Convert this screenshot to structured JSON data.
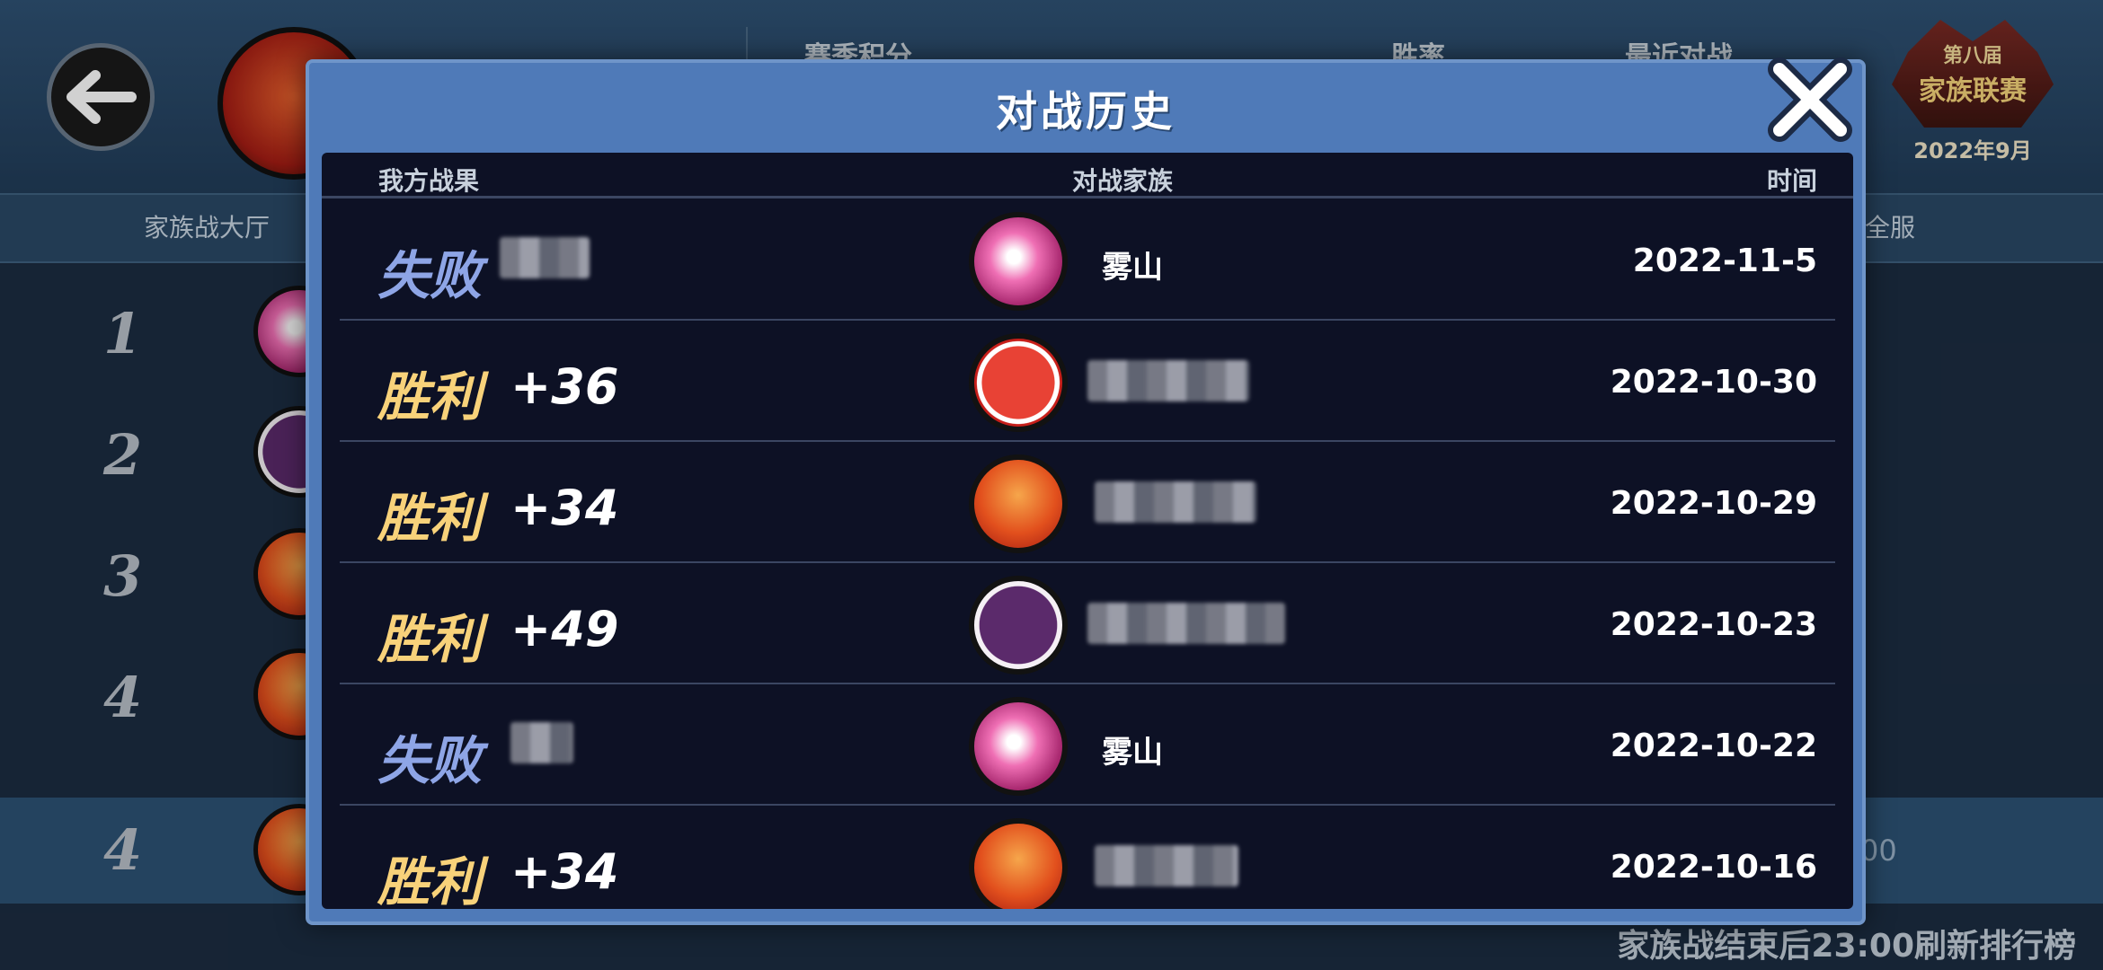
{
  "header": {
    "labels": [
      "赛季积分",
      "胜率",
      "最近对战"
    ],
    "season_badge": {
      "line1": "第八届",
      "line2": "家族联赛",
      "line3": "2022年9月"
    }
  },
  "tabs": [
    "家族战大厅",
    "全服"
  ],
  "ranks": [
    "1",
    "2",
    "3",
    "4",
    "4"
  ],
  "bg_time_fragment": "00",
  "footer_note": "家族战结束后23:00刷新排行榜",
  "modal": {
    "title": "对战历史",
    "columns": {
      "result": "我方战果",
      "opponent": "对战家族",
      "time": "时间"
    },
    "rows": [
      {
        "result": "失败",
        "score": "",
        "opponent": "雾山",
        "date": "2022-11-5",
        "emblem": "pink"
      },
      {
        "result": "胜利",
        "score": "+36",
        "opponent": "",
        "date": "2022-10-30",
        "emblem": "red-white"
      },
      {
        "result": "胜利",
        "score": "+34",
        "opponent": "",
        "date": "2022-10-29",
        "emblem": "orange"
      },
      {
        "result": "胜利",
        "score": "+49",
        "opponent": "",
        "date": "2022-10-23",
        "emblem": "purple"
      },
      {
        "result": "失败",
        "score": "",
        "opponent": "雾山",
        "date": "2022-10-22",
        "emblem": "pink"
      },
      {
        "result": "胜利",
        "score": "+34",
        "opponent": "",
        "date": "2022-10-16",
        "emblem": "orange"
      }
    ]
  },
  "colors": {
    "win": "#f8d27a",
    "loss": "#8ea5e6",
    "modal_frame": "#4f7ab8",
    "panel": "#0d1125"
  },
  "icons": {
    "back": "arrow-left-icon",
    "close": "close-x-icon"
  }
}
